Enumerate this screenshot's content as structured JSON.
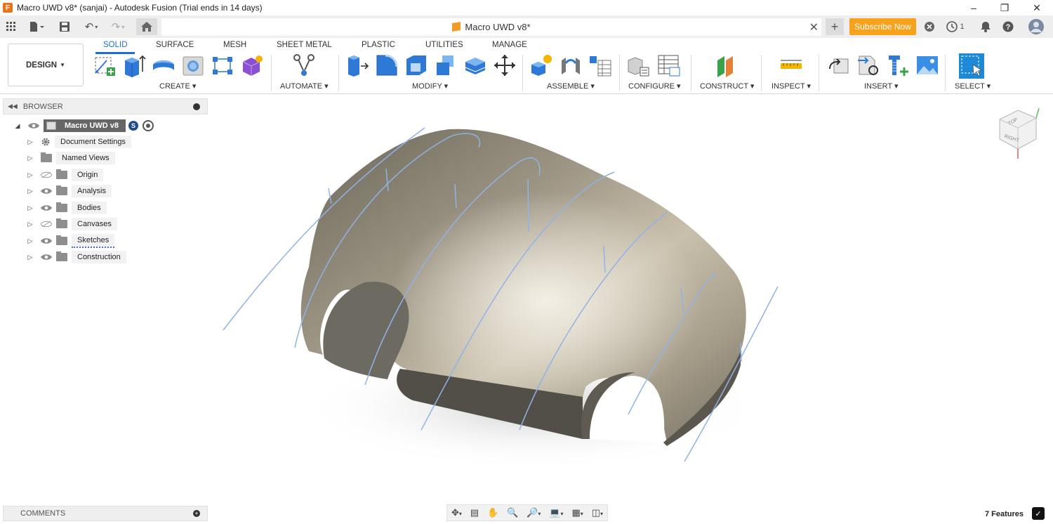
{
  "window": {
    "title": "Macro UWD v8* (sanjai) - Autodesk Fusion (Trial ends in 14 days)"
  },
  "document": {
    "tab_title": "Macro UWD v8*"
  },
  "header": {
    "subscribe_label": "Subscribe Now",
    "job_count": "1"
  },
  "workspace": {
    "label": "DESIGN"
  },
  "ribbon": {
    "tabs": [
      {
        "label": "SOLID",
        "active": true
      },
      {
        "label": "SURFACE"
      },
      {
        "label": "MESH"
      },
      {
        "label": "SHEET METAL"
      },
      {
        "label": "PLASTIC"
      },
      {
        "label": "UTILITIES"
      },
      {
        "label": "MANAGE"
      }
    ],
    "groups": {
      "create": "CREATE",
      "automate": "AUTOMATE",
      "modify": "MODIFY",
      "assemble": "ASSEMBLE",
      "configure": "CONFIGURE",
      "construct": "CONSTRUCT",
      "inspect": "INSPECT",
      "insert": "INSERT",
      "select": "SELECT"
    }
  },
  "browser": {
    "title": "BROWSER",
    "root": "Macro UWD v8",
    "items": [
      {
        "label": "Document Settings"
      },
      {
        "label": "Named Views"
      },
      {
        "label": "Origin"
      },
      {
        "label": "Analysis"
      },
      {
        "label": "Bodies"
      },
      {
        "label": "Canvases"
      },
      {
        "label": "Sketches"
      },
      {
        "label": "Construction"
      }
    ]
  },
  "comments": {
    "title": "COMMENTS"
  },
  "viewcube": {
    "faces": [
      "TOP",
      "RIGHT"
    ]
  },
  "status": {
    "feature_count": "7 Features"
  },
  "colors": {
    "accent": "#1a6fd1",
    "subscribe": "#f7a21b",
    "sketch_line": "#8fb3e6"
  }
}
